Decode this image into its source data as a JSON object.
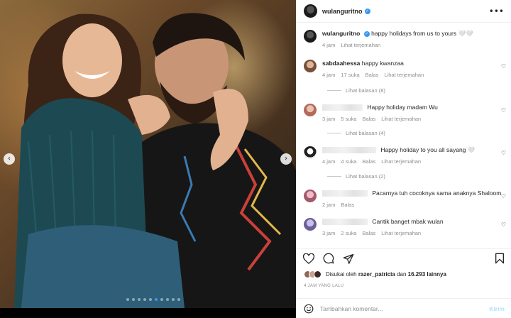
{
  "post": {
    "username": "wulanguritno",
    "caption": "happy holidays from us to yours 🤍🤍",
    "caption_time": "4 jam",
    "caption_translate": "Lihat terjemahan"
  },
  "comments": [
    {
      "username": "sabdaahessa",
      "text": "happy kwanzaa",
      "time": "4 jam",
      "likes": "17 suka",
      "reply": "Balas",
      "translate": "Lihat terjemahan",
      "view_replies": "Lihat balasan (8)"
    },
    {
      "username": "",
      "text": "Happy holiday madam Wu",
      "time": "3 jam",
      "likes": "5 suka",
      "reply": "Balas",
      "translate": "Lihat terjemahan",
      "view_replies": "Lihat balasan (4)"
    },
    {
      "username": "",
      "text": "Happy holiday to you all sayang 🤍",
      "time": "4 jam",
      "likes": "4 suka",
      "reply": "Balas",
      "translate": "Lihat terjemahan",
      "view_replies": "Lihat balasan (2)"
    },
    {
      "username": "",
      "text": "Pacarnya tuh cocoknya sama anaknya Shaloom",
      "time": "2 jam",
      "reply": "Balas"
    },
    {
      "username": "",
      "text": "Cantik banget mbak wulan",
      "time": "3 jam",
      "likes": "2 suka",
      "reply": "Balas",
      "translate": "Lihat terjemahan"
    }
  ],
  "likes": {
    "prefix": "Disukai oleh",
    "user": "razer_patricia",
    "middle": "dan",
    "count": "16.293",
    "suffix": "lainnya"
  },
  "timestamp": "4 JAM YANG LALU",
  "composer": {
    "placeholder": "Tambahkan komentar...",
    "post_label": "Kirim"
  },
  "carousel": {
    "total": 10,
    "active": 6
  },
  "icons": {
    "more": "more-icon",
    "heart": "heart-icon",
    "comment": "comment-icon",
    "share": "share-icon",
    "bookmark": "bookmark-icon",
    "emoji": "emoji-icon",
    "prev": "chevron-left-icon",
    "next": "chevron-right-icon"
  },
  "colors": {
    "link": "#3897f0",
    "muted": "#8e8e8e",
    "text": "#262626"
  }
}
